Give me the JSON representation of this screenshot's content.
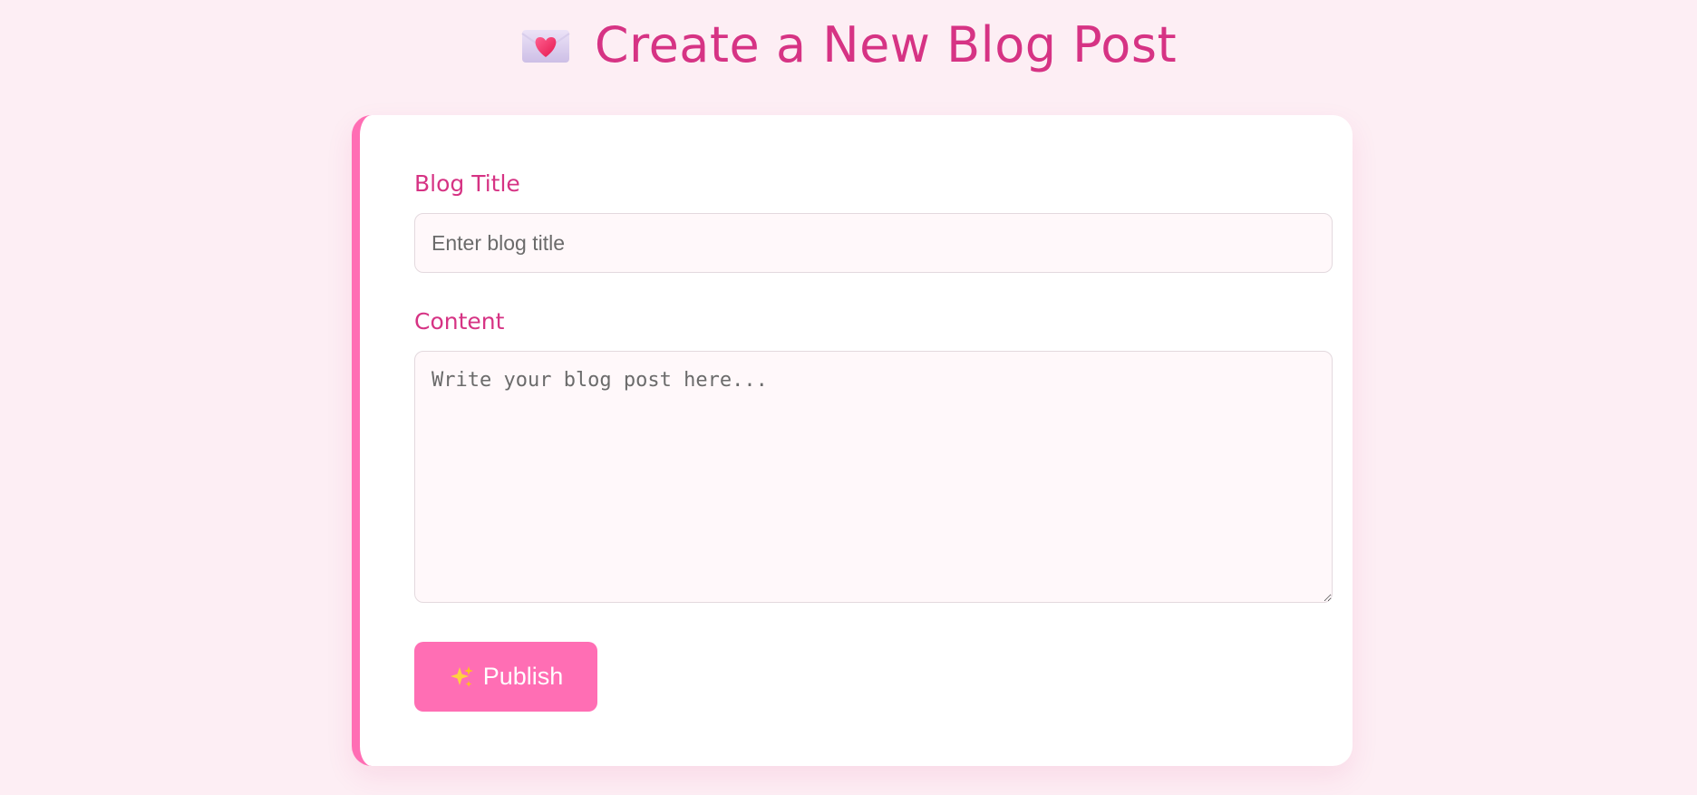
{
  "header": {
    "title": "Create a New Blog Post",
    "icon": "love-letter-icon"
  },
  "form": {
    "title_label": "Blog Title",
    "title_placeholder": "Enter blog title",
    "title_value": "",
    "content_label": "Content",
    "content_placeholder": "Write your blog post here...",
    "content_value": "",
    "publish_label": "Publish",
    "publish_icon": "sparkles-icon"
  },
  "colors": {
    "background": "#fdeef4",
    "accent": "#ff6eb4",
    "heading": "#d63384",
    "card": "#ffffff",
    "input_background": "#fff8fa"
  }
}
